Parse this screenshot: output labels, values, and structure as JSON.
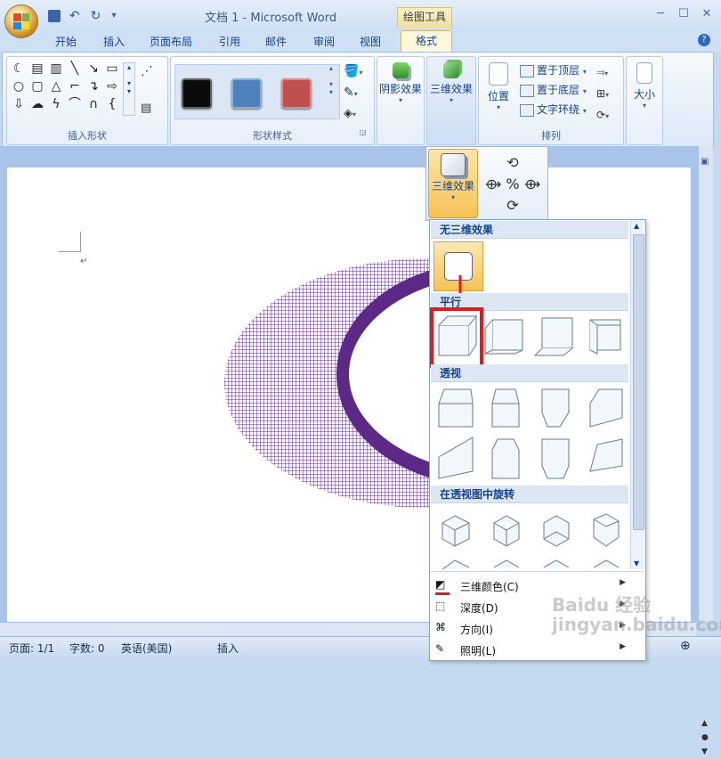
{
  "window": {
    "title": "文档 1 - Microsoft Word",
    "context_tab_group": "绘图工具",
    "controls": [
      "─",
      "☐",
      "✕"
    ]
  },
  "tabs": [
    "开始",
    "插入",
    "页面布局",
    "引用",
    "邮件",
    "审阅",
    "视图",
    "格式"
  ],
  "active_tab": "格式",
  "ribbon": {
    "groups": {
      "insert_shapes": "插入形状",
      "shape_styles": "形状样式",
      "arrange": "排列"
    },
    "shape_style_swatches": [
      "#0b0b0b",
      "#4f81bd",
      "#c0504d"
    ],
    "shadow_effects": "阴影效果",
    "three_d_effects": "三维效果",
    "position": "位置",
    "bring_to_front": "置于顶层",
    "send_to_back": "置于底层",
    "text_wrapping": "文字环绕",
    "size": "大小"
  },
  "submenu_3d": {
    "button_label": "三维效果"
  },
  "gallery": {
    "no_3d": "无三维效果",
    "parallel": "平行",
    "perspective": "透视",
    "rotation_in_perspective": "在透视图中旋转",
    "menu": [
      {
        "icon": "paint-bucket-icon",
        "label": "三维颜色(C)"
      },
      {
        "icon": "depth-icon",
        "label": "深度(D)"
      },
      {
        "icon": "direction-icon",
        "label": "方向(I)"
      },
      {
        "icon": "lighting-icon",
        "label": "照明(L)"
      }
    ]
  },
  "statusbar": {
    "page": "页面: 1/1",
    "words": "字数: 0",
    "language": "英语(美国)",
    "mode": "插入"
  },
  "watermark": "Baidu 经验 jingyan.baidu.com",
  "colors": {
    "highlight_red": "#e51a1a",
    "ellipse_purple": "#5c2a86",
    "accent_orange": "#f6c256"
  }
}
